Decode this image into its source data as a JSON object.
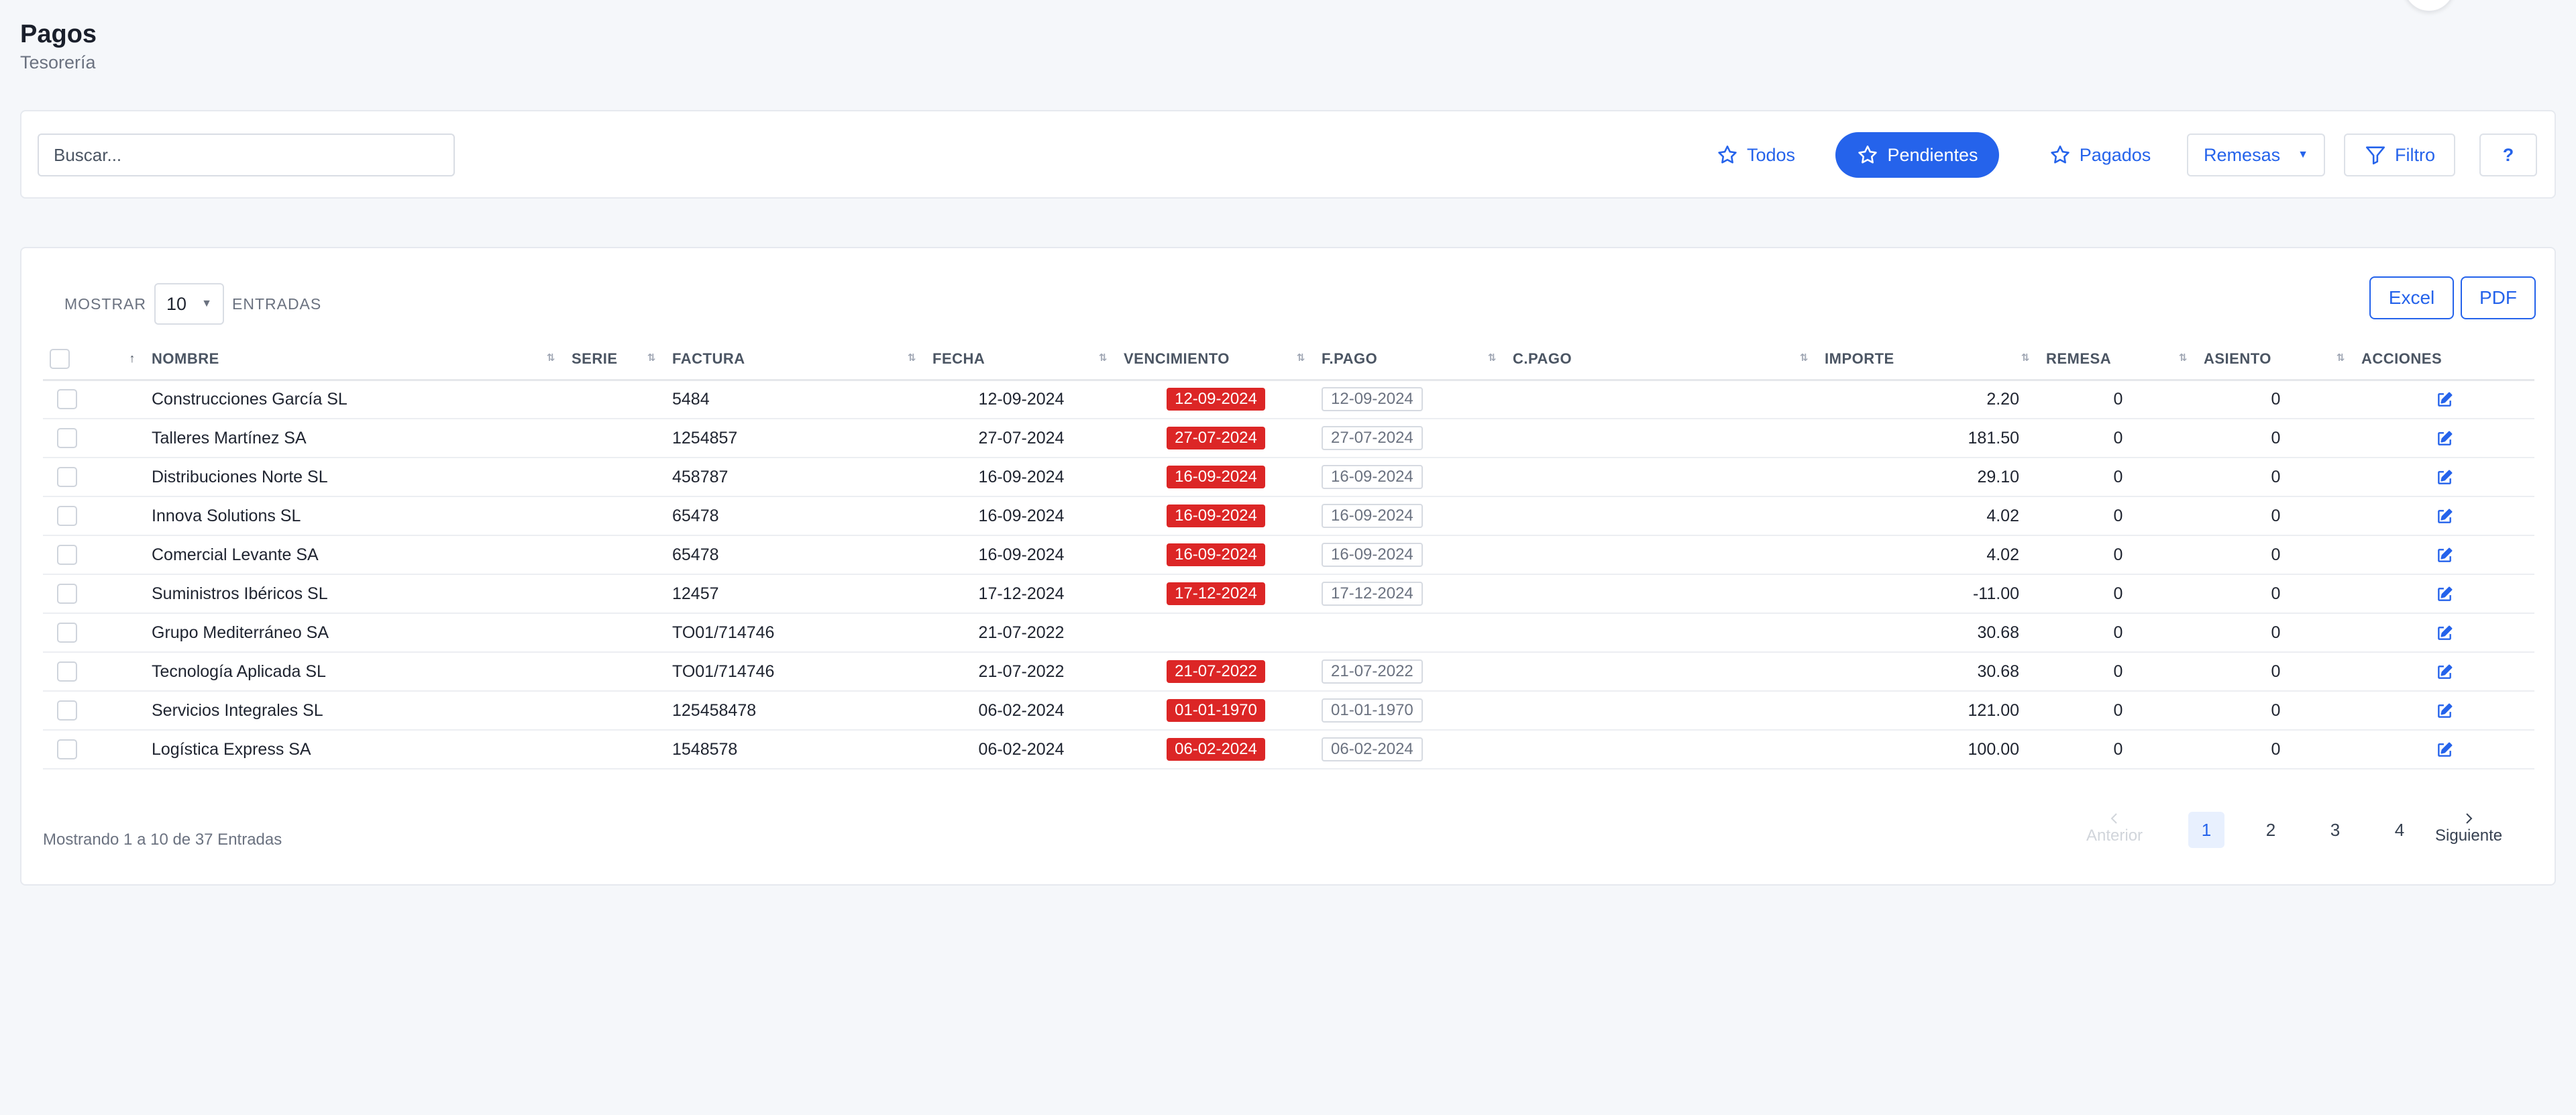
{
  "header": {
    "title": "Pagos",
    "subtitle": "Tesorería"
  },
  "toolbar": {
    "search_placeholder": "Buscar...",
    "todos": "Todos",
    "pendientes": "Pendientes",
    "pagados": "Pagados",
    "remesas": "Remesas",
    "filtro": "Filtro",
    "help": "?"
  },
  "table_controls": {
    "show_label": "MOSTRAR",
    "entries_label": "ENTRADAS",
    "page_size": "10",
    "excel": "Excel",
    "pdf": "PDF"
  },
  "columns": {
    "sort_arrow": "↑",
    "nombre": "NOMBRE",
    "serie": "SERIE",
    "factura": "FACTURA",
    "fecha": "FECHA",
    "vencimiento": "VENCIMIENTO",
    "fpago": "F.PAGO",
    "cpago": "C.PAGO",
    "importe": "IMPORTE",
    "remesa": "REMESA",
    "asiento": "ASIENTO",
    "acciones": "ACCIONES"
  },
  "rows": [
    {
      "nombre": "Construcciones García SL",
      "serie": "",
      "factura": "5484",
      "fecha": "12-09-2024",
      "vencimiento": "12-09-2024",
      "fpago": "12-09-2024",
      "cpago": "",
      "importe": "2.20",
      "remesa": "0",
      "asiento": "0"
    },
    {
      "nombre": "Talleres Martínez SA",
      "serie": "",
      "factura": "1254857",
      "fecha": "27-07-2024",
      "vencimiento": "27-07-2024",
      "fpago": "27-07-2024",
      "cpago": "",
      "importe": "181.50",
      "remesa": "0",
      "asiento": "0"
    },
    {
      "nombre": "Distribuciones Norte SL",
      "serie": "",
      "factura": "458787",
      "fecha": "16-09-2024",
      "vencimiento": "16-09-2024",
      "fpago": "16-09-2024",
      "cpago": "",
      "importe": "29.10",
      "remesa": "0",
      "asiento": "0"
    },
    {
      "nombre": "Innova Solutions SL",
      "serie": "",
      "factura": "65478",
      "fecha": "16-09-2024",
      "vencimiento": "16-09-2024",
      "fpago": "16-09-2024",
      "cpago": "",
      "importe": "4.02",
      "remesa": "0",
      "asiento": "0"
    },
    {
      "nombre": "Comercial Levante SA",
      "serie": "",
      "factura": "65478",
      "fecha": "16-09-2024",
      "vencimiento": "16-09-2024",
      "fpago": "16-09-2024",
      "cpago": "",
      "importe": "4.02",
      "remesa": "0",
      "asiento": "0"
    },
    {
      "nombre": "Suministros Ibéricos SL",
      "serie": "",
      "factura": "12457",
      "fecha": "17-12-2024",
      "vencimiento": "17-12-2024",
      "fpago": "17-12-2024",
      "cpago": "",
      "importe": "-11.00",
      "remesa": "0",
      "asiento": "0"
    },
    {
      "nombre": "Grupo Mediterráneo SA",
      "serie": "",
      "factura": "TO01/714746",
      "fecha": "21-07-2022",
      "vencimiento": "",
      "fpago": "",
      "cpago": "",
      "importe": "30.68",
      "remesa": "0",
      "asiento": "0"
    },
    {
      "nombre": "Tecnología Aplicada SL",
      "serie": "",
      "factura": "TO01/714746",
      "fecha": "21-07-2022",
      "vencimiento": "21-07-2022",
      "fpago": "21-07-2022",
      "cpago": "",
      "importe": "30.68",
      "remesa": "0",
      "asiento": "0"
    },
    {
      "nombre": "Servicios Integrales SL",
      "serie": "",
      "factura": "125458478",
      "fecha": "06-02-2024",
      "vencimiento": "01-01-1970",
      "fpago": "01-01-1970",
      "cpago": "",
      "importe": "121.00",
      "remesa": "0",
      "asiento": "0"
    },
    {
      "nombre": "Logística Express SA",
      "serie": "",
      "factura": "1548578",
      "fecha": "06-02-2024",
      "vencimiento": "06-02-2024",
      "fpago": "06-02-2024",
      "cpago": "",
      "importe": "100.00",
      "remesa": "0",
      "asiento": "0"
    }
  ],
  "footer": {
    "info": "Mostrando 1 a 10 de 37 Entradas",
    "prev": "Anterior",
    "next": "Siguiente",
    "pages": [
      "1",
      "2",
      "3",
      "4"
    ],
    "current_page": "1"
  },
  "colors": {
    "accent": "#2563eb",
    "danger": "#dc2626"
  }
}
